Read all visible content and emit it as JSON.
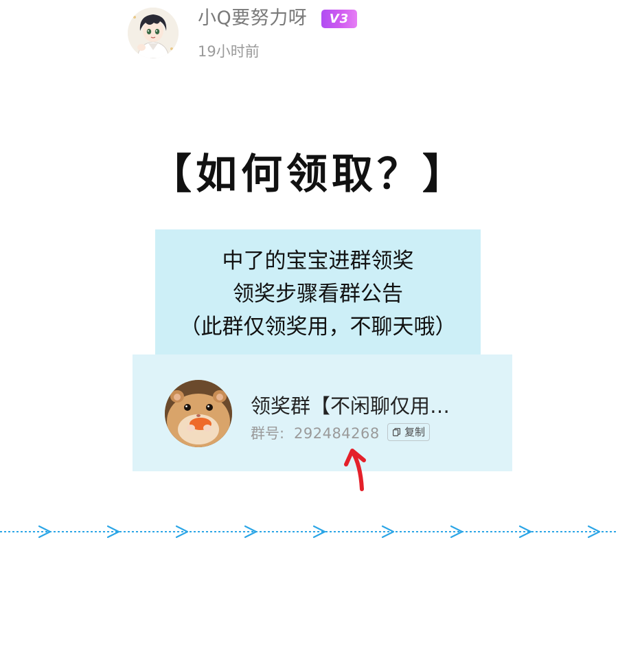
{
  "post": {
    "username": "小Q要努力呀",
    "vip_badge": "V3",
    "time": "19小时前"
  },
  "headline": "【如何领取？】",
  "info_card": {
    "line1": "中了的宝宝进群领奖",
    "line2": "领奖步骤看群公告",
    "line3": "（此群仅领奖用，不聊天哦）"
  },
  "group_card": {
    "name": "领奖群【不闲聊仅用…",
    "id_label": "群号:",
    "id_value": "292484268",
    "copy_label": "复制"
  },
  "colors": {
    "vip_gradient_start": "#b04df2",
    "info_card_bg": "#cdeff7",
    "group_card_bg": "#def3f9",
    "arrow_red": "#e4202a",
    "divider_blue": "#2ba5e6"
  },
  "icons": {
    "user_avatar": "anime-boy-avatar",
    "group_avatar": "hamster-avatar",
    "copy": "copy-icon",
    "pointer": "red-up-arrow-icon",
    "divider": "dotted-arrow-divider"
  }
}
